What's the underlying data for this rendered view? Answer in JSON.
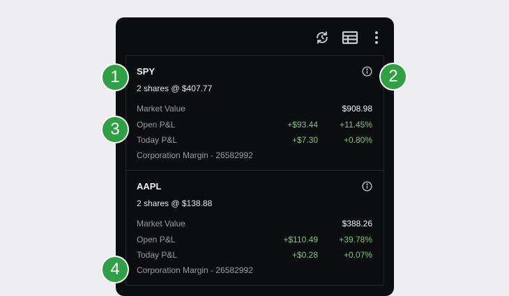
{
  "toolbar": {
    "refresh_icon": "refresh-icon",
    "table_icon": "table-view-icon",
    "more_icon": "more-vertical-icon"
  },
  "positions": [
    {
      "symbol": "SPY",
      "shares": "2 shares @ $407.77",
      "market_value_label": "Market Value",
      "market_value": "$908.98",
      "open_pl_label": "Open P&L",
      "open_pl_value": "+$93.44",
      "open_pl_pct": "+11.45%",
      "today_pl_label": "Today P&L",
      "today_pl_value": "+$7.30",
      "today_pl_pct": "+0.80%",
      "account": "Corporation Margin - 26582992"
    },
    {
      "symbol": "AAPL",
      "shares": "2 shares @ $138.88",
      "market_value_label": "Market Value",
      "market_value": "$388.26",
      "open_pl_label": "Open P&L",
      "open_pl_value": "+$110.49",
      "open_pl_pct": "+39.78%",
      "today_pl_label": "Today P&L",
      "today_pl_value": "+$0.28",
      "today_pl_pct": "+0.07%",
      "account": "Corporation Margin - 26582992"
    }
  ],
  "badges": [
    "1",
    "2",
    "3",
    "4"
  ],
  "colors": {
    "accent_green": "#2fa043",
    "positive": "#7ec77e",
    "panel_bg": "#0c0d10"
  }
}
